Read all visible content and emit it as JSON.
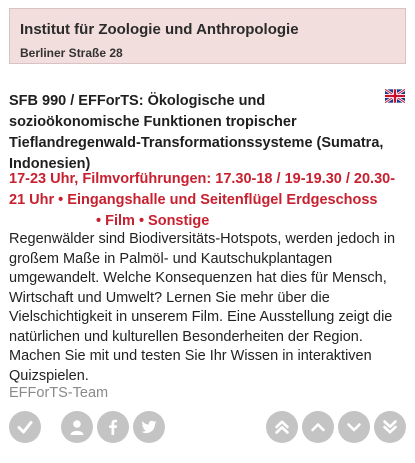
{
  "institute": {
    "name": "Institut für Zoologie und Anthropologie",
    "address": "Berliner Straße 28"
  },
  "event": {
    "title": "SFB 990 / EFForTS: Ökologische und sozioökonomische Funktionen tropischer Tieflandregenwald-Transformationssysteme (Sumatra, Indonesien)",
    "time": "17-23 Uhr, Filmvorführungen: 17.30-18 / 19-19.30 / 20.30-21 Uhr",
    "separator": " • ",
    "location": "Eingangshalle und Seitenflügel Erdgeschoss",
    "categories": "Film • Sonstige",
    "description": "Regenwälder sind Biodiversitäts-Hotspots, werden jedoch in großem Maße in Palmöl- und Kautschukplantagen umgewandelt. Welche Konsequenzen hat dies für Mensch, Wirtschaft und Umwelt? Lernen Sie mehr über die Vielschichtigkeit in unserem Film. Eine Ausstellung zeigt die natürlichen und kulturellen Besonderheiten der Region. Machen Sie mit und testen Sie Ihr Wissen in interaktiven Quizspielen.",
    "author": "EFForTS-Team"
  },
  "icons": {
    "language_flag": "uk-flag-icon",
    "actions": [
      "check-icon",
      "user-icon",
      "facebook-icon",
      "twitter-icon"
    ],
    "navigation": [
      "double-up-icon",
      "up-icon",
      "down-icon",
      "double-down-icon"
    ]
  },
  "colors": {
    "header_bg": "#f3dede",
    "accent_red": "#c8202f",
    "button_gray": "#c4c4c4",
    "author_gray": "#8a8a8a"
  }
}
